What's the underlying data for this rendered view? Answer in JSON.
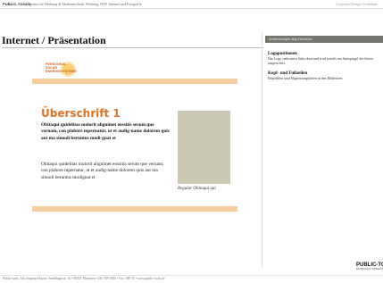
{
  "topbar": {
    "brand": "PUBLIC-TOOLS",
    "tagline": "· Agentur für Werbung & Markentechnik: Werbung, DTP, Internet und Fotografie",
    "guide_label": "Corporate-Design-Guidelines"
  },
  "page": {
    "title": "Internet / Präsentation"
  },
  "mockup": {
    "logo_lines": [
      "PERSONNAL",
      "SOLAR",
      "ENERGIESYSTEME"
    ],
    "band_color": "#f8cda0",
    "headline": "Überschrift 1",
    "lead_text": "Obitaqui quidelitas molorit alignimet eossitis serum que vernam, con plabore mpernatur, ut et audig-name dolorem quis aut ma simodi beruntus modi-gnat et",
    "body_text": "Obitaqui quidelitas molorit alignimet eossitis serum que vernam, con plabore mpernatur, ut et audig-name dolorem quis aut ma simodi beruntus modignat et",
    "image_color": "#cbc8b3",
    "caption": "Regular Obitaqui qui"
  },
  "sidebar": {
    "header": "Anwendungen allg./Hinweise",
    "notes": [
      {
        "title": "Logopositionen",
        "text": "Das Logo steht meist links oben und wird jeweils am Satzspiegel der Seiten ausgerichtet."
      },
      {
        "title": "Kopf- und Fußzeilen",
        "text": "Empfehlen sind Abgrenzungslinien in den Bildleisten."
      }
    ]
  },
  "corner_logo": {
    "name": "PUBLIC-TO",
    "sub": "WERBUNG & KOMMUNIK"
  },
  "footer": {
    "text": "Public-tools, Inh. Stephan Hauser, Sendlingerstr. 34 • 80331 München • Tel: 089 3600 • Fax: 089 31 • www.public-tools.de"
  },
  "colors": {
    "accent_orange": "#e07424",
    "sidebar_header_bg": "#777772"
  }
}
